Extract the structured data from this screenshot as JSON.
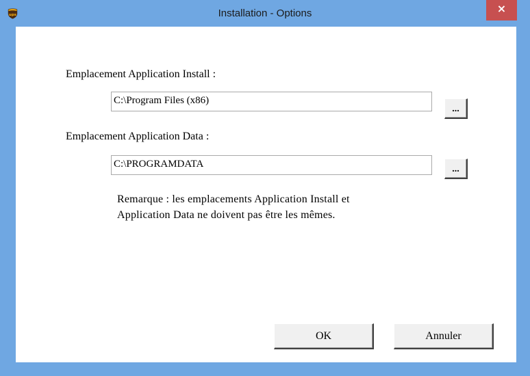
{
  "window": {
    "title": "Installation - Options",
    "close_label": "×",
    "icon": "ups-shield-icon"
  },
  "form": {
    "install_label": "Emplacement Application Install :",
    "install_path": "C:\\Program Files (x86)",
    "install_browse": "...",
    "data_label": "Emplacement Application Data :",
    "data_path": "C:\\PROGRAMDATA",
    "data_browse": "...",
    "note_line1": "Remarque : les emplacements Application Install et",
    "note_line2": "Application Data ne doivent pas être les mêmes."
  },
  "buttons": {
    "ok": "OK",
    "cancel": "Annuler"
  },
  "colors": {
    "titlebar": "#6fa7e2",
    "close": "#c75050",
    "icon_brown": "#4b2a10",
    "icon_gold": "#f5b013"
  }
}
